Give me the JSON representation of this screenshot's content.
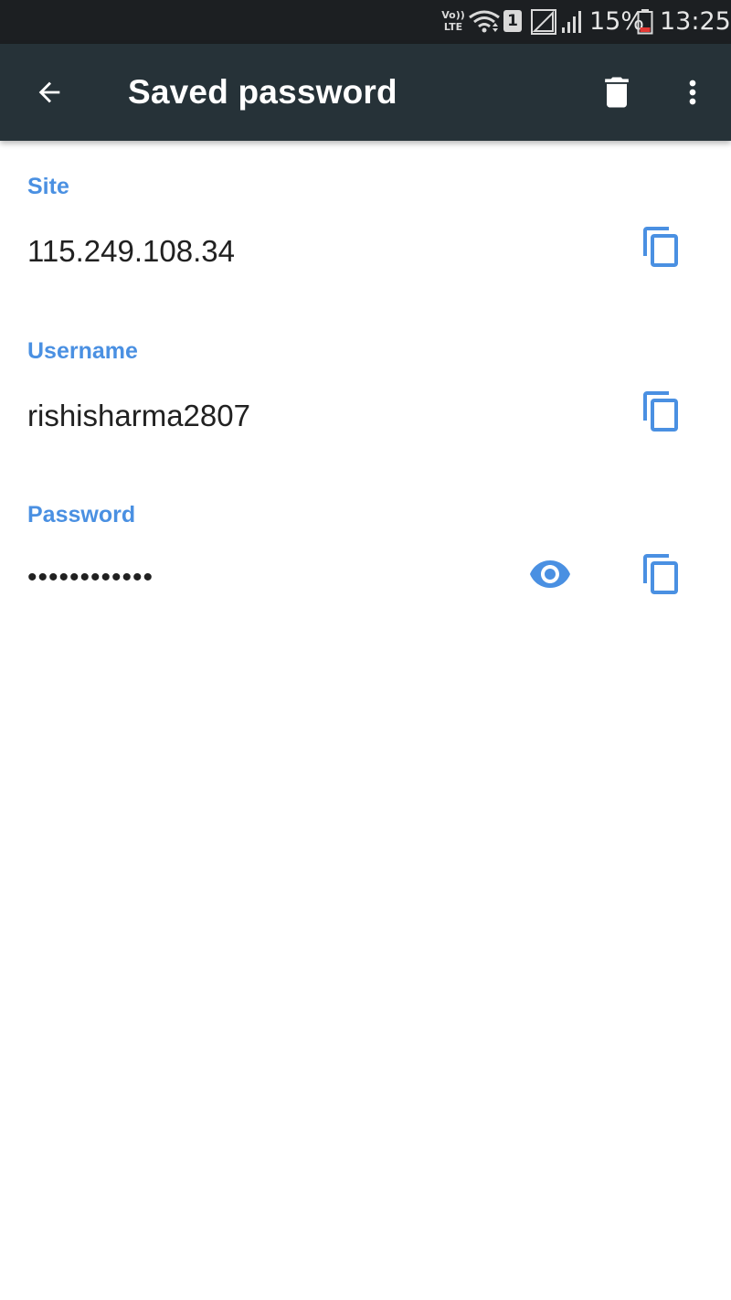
{
  "status_bar": {
    "volte_line1": "Vo))",
    "volte_line2": "LTE",
    "sim_slot": "1",
    "battery_percent": "15%",
    "time": "13:25",
    "icons": [
      "volte-icon",
      "wifi-icon",
      "sim-icon",
      "signal-icon",
      "battery-icon"
    ]
  },
  "app_bar": {
    "title": "Saved password",
    "back_icon": "arrow-back-icon",
    "delete_icon": "trash-icon",
    "more_icon": "more-vert-icon",
    "background": "#263238"
  },
  "fields": {
    "site": {
      "label": "Site",
      "value": "115.249.108.34"
    },
    "username": {
      "label": "Username",
      "value": "rishisharma2807"
    },
    "password": {
      "label": "Password",
      "value": "••••••••••••"
    }
  },
  "colors": {
    "accent": "#4a90e2",
    "text": "#212121",
    "status_bar": "#1c1f22"
  }
}
